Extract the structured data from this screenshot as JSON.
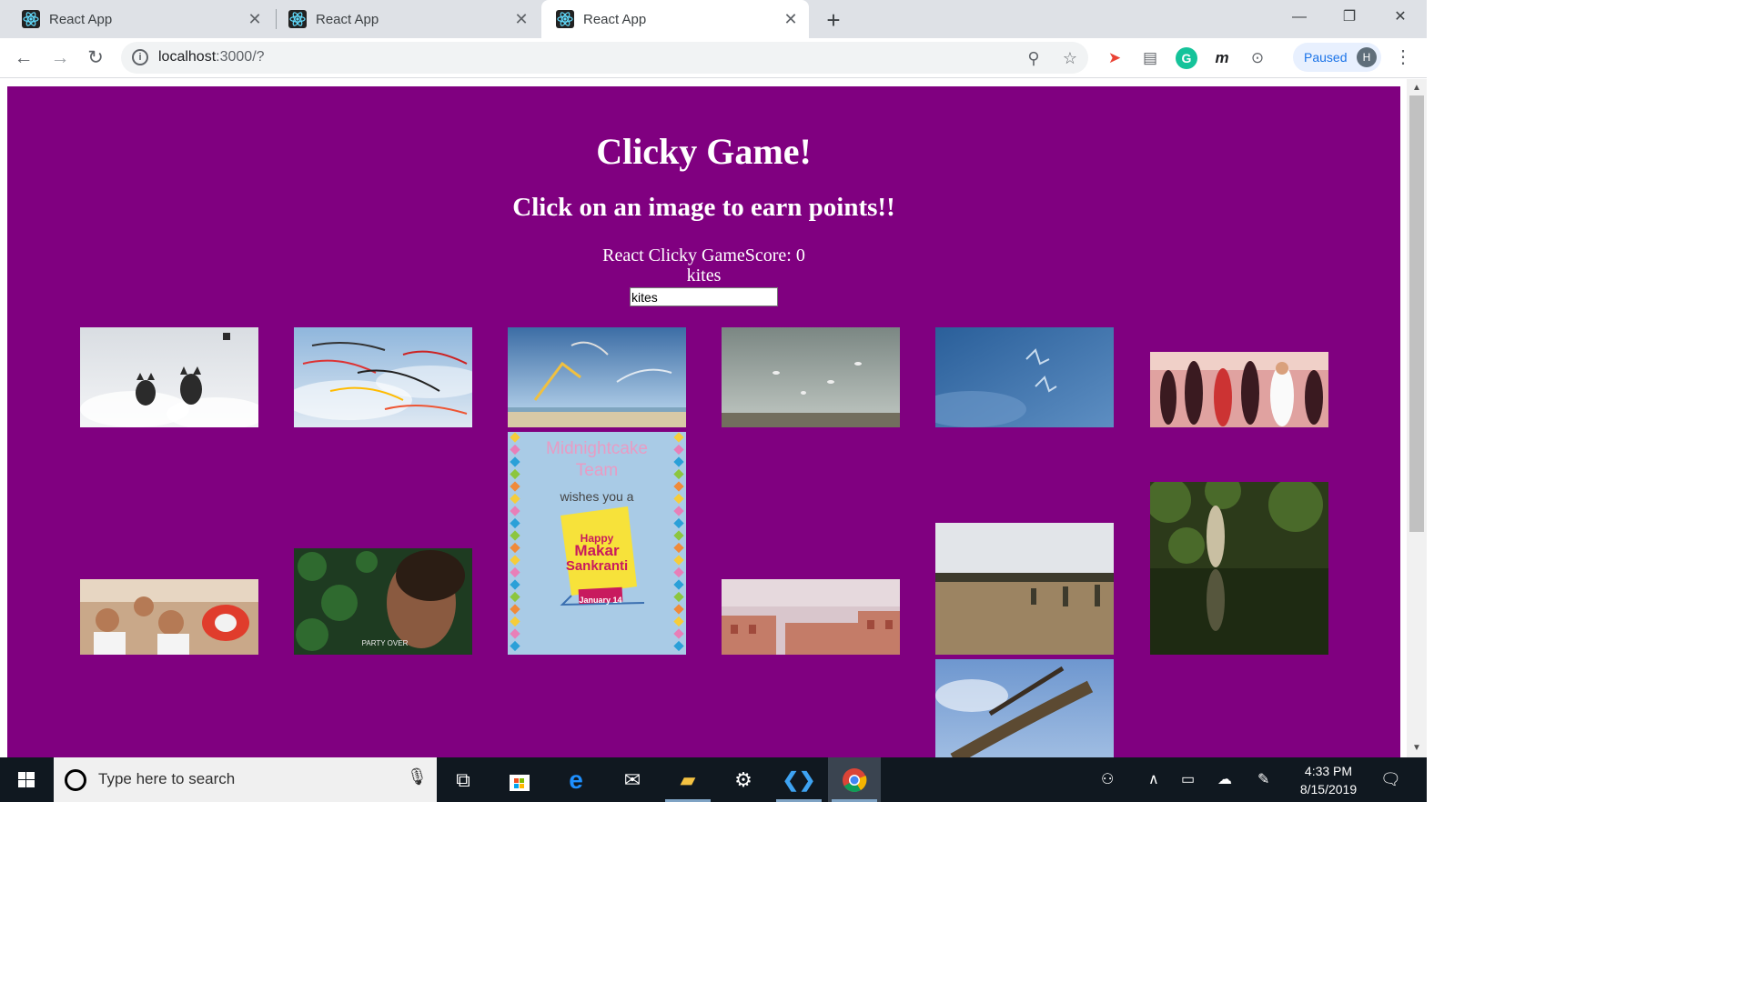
{
  "browser": {
    "tabs": [
      {
        "title": "React App",
        "active": false
      },
      {
        "title": "React App",
        "active": false
      },
      {
        "title": "React App",
        "active": true
      }
    ],
    "url_host": "localhost",
    "url_rest": ":3000/?",
    "profile_status": "Paused",
    "profile_initial": "H"
  },
  "page": {
    "title": "Clicky Game!",
    "subtitle": "Click on an image to earn points!!",
    "score_line": "React Clicky GameScore: 0",
    "topic_label": "kites",
    "filter_value": "kites",
    "background_color": "#800080",
    "images": [
      {
        "name": "kite-image-cat-kites",
        "caption": ""
      },
      {
        "name": "kite-image-sky-full-of-kites",
        "caption": ""
      },
      {
        "name": "kite-image-beach-kites",
        "caption": ""
      },
      {
        "name": "kite-image-cloudy-sea",
        "caption": ""
      },
      {
        "name": "kite-image-blue-sky-birds",
        "caption": ""
      },
      {
        "name": "kite-image-festival-dance",
        "caption": ""
      },
      {
        "name": "kite-image-sankranti-card",
        "card_line1": "Midnightcake",
        "card_line2": "Team",
        "card_line3": "wishes you a",
        "card_line4": "Happy",
        "card_line5": "Makar",
        "card_line6": "Sankranti",
        "card_line7": "January 14"
      },
      {
        "name": "kite-image-men-with-spool",
        "caption": ""
      },
      {
        "name": "kite-image-party-over",
        "caption": "PARTY OVER"
      },
      {
        "name": "kite-image-rooftops",
        "caption": ""
      },
      {
        "name": "kite-image-field-flyers",
        "caption": ""
      },
      {
        "name": "kite-image-forest-reflection",
        "caption": ""
      },
      {
        "name": "kite-image-grasshopper-closeup",
        "caption": ""
      }
    ]
  },
  "taskbar": {
    "search_placeholder": "Type here to search",
    "time": "4:33 PM",
    "date": "8/15/2019"
  }
}
